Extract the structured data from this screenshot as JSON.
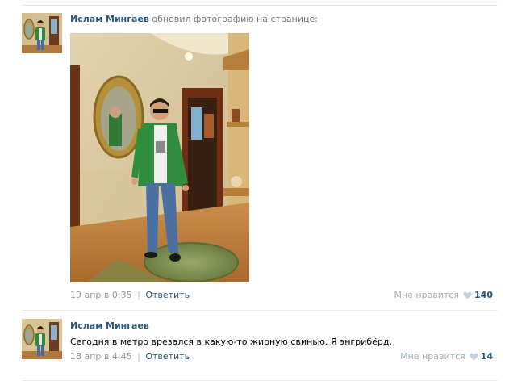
{
  "post1": {
    "author": "Ислам Мингаев",
    "action": "обновил фотографию на странице:",
    "date": "19 апр в 0:35",
    "separator": "|",
    "reply": "Ответить",
    "like_label": "Мне нравится",
    "like_count": "140"
  },
  "post2": {
    "author": "Ислам Мингаев",
    "text": "Сегодня в метро врезался в какую-то жирную свинью. Я энгрибёрд.",
    "date": "18 апр в 4:45",
    "separator": "|",
    "reply": "Ответить",
    "like_label": "Мне нравится",
    "like_count": "14"
  },
  "icons": {
    "like": "heart-icon"
  },
  "colors": {
    "link": "#2b587a",
    "muted": "#999999",
    "like_label": "#9daebd",
    "heart": "#c4d0dc",
    "divider": "#e4e8ee"
  }
}
